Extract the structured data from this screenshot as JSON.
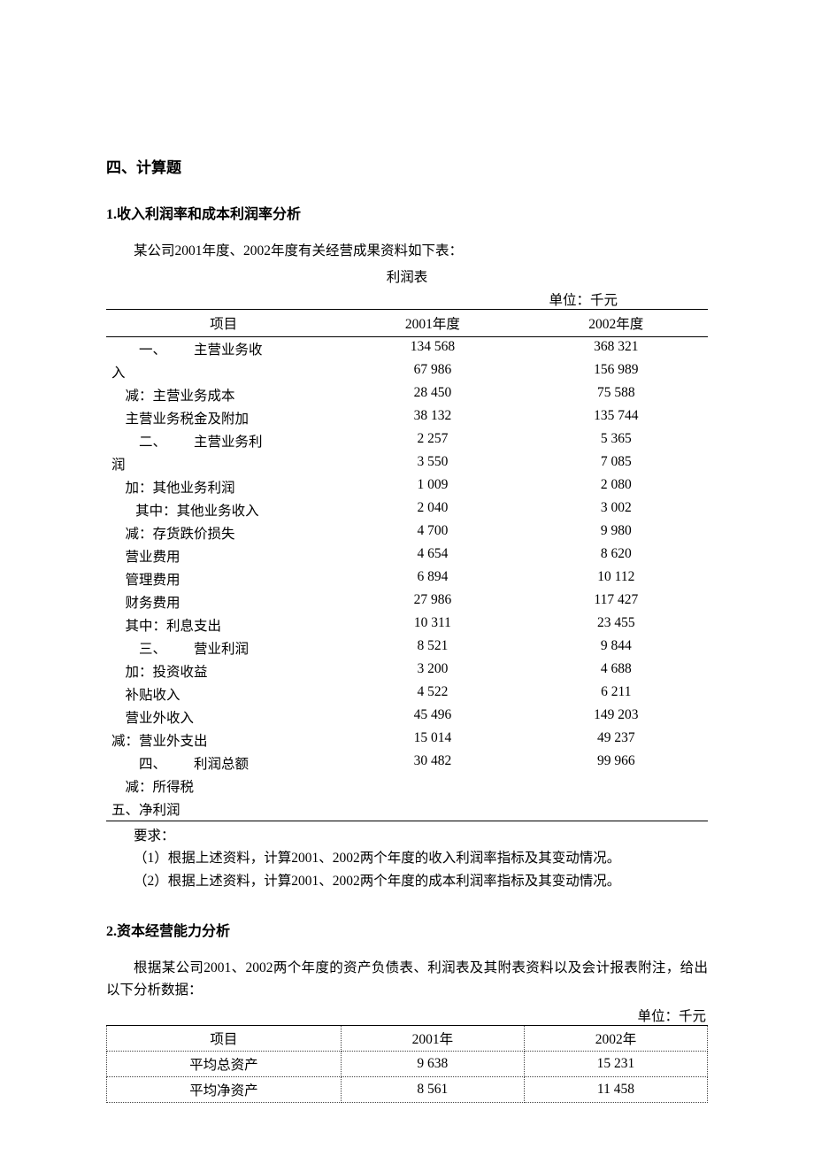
{
  "section_heading": "四、计算题",
  "q1": {
    "title": "1.收入利润率和成本利润率分析",
    "intro": "某公司2001年度、2002年度有关经营成果资料如下表：",
    "table_title": "利润表",
    "unit": "单位：千元",
    "columns": [
      "项目",
      "2001年度",
      "2002年度"
    ],
    "rows": [
      {
        "item": "        一、        主营业务收",
        "y2001": "134 568",
        "y2002": "368 321"
      },
      {
        "item": "入",
        "y2001": "67 986",
        "y2002": "156 989"
      },
      {
        "item": "    减：主营业务成本",
        "y2001": "28 450",
        "y2002": "75 588"
      },
      {
        "item": "    主营业务税金及附加",
        "y2001": "38 132",
        "y2002": "135 744"
      },
      {
        "item": "        二、        主营业务利",
        "y2001": "2 257",
        "y2002": "5 365"
      },
      {
        "item": "润",
        "y2001": "3 550",
        "y2002": "7 085"
      },
      {
        "item": "    加：其他业务利润",
        "y2001": "1 009",
        "y2002": "2 080"
      },
      {
        "item": "       其中：其他业务收入",
        "y2001": "2 040",
        "y2002": "3 002"
      },
      {
        "item": "    减：存货跌价损失",
        "y2001": "4 700",
        "y2002": "9 980"
      },
      {
        "item": "    营业费用",
        "y2001": "4 654",
        "y2002": "8 620"
      },
      {
        "item": "    管理费用",
        "y2001": "6 894",
        "y2002": "10 112"
      },
      {
        "item": "    财务费用",
        "y2001": "27 986",
        "y2002": "117 427"
      },
      {
        "item": "    其中：利息支出",
        "y2001": "10 311",
        "y2002": "23 455"
      },
      {
        "item": "        三、        营业利润",
        "y2001": "8 521",
        "y2002": "9 844"
      },
      {
        "item": "    加：投资收益",
        "y2001": "3 200",
        "y2002": "4 688"
      },
      {
        "item": "    补贴收入",
        "y2001": "4 522",
        "y2002": "6 211"
      },
      {
        "item": "    营业外收入",
        "y2001": "45 496",
        "y2002": "149 203"
      },
      {
        "item": "减：营业外支出",
        "y2001": "15 014",
        "y2002": "49 237"
      },
      {
        "item": "        四、        利润总额",
        "y2001": "30 482",
        "y2002": "99 966"
      },
      {
        "item": "    减：所得税",
        "y2001": "",
        "y2002": ""
      },
      {
        "item": "五、净利润",
        "y2001": "",
        "y2002": ""
      }
    ],
    "req_label": "要求：",
    "req1": "（1）根据上述资料，计算2001、2002两个年度的收入利润率指标及其变动情况。",
    "req2": "（2）根据上述资料，计算2001、2002两个年度的成本利润率指标及其变动情况。"
  },
  "q2": {
    "title": "2.资本经营能力分析",
    "intro": "根据某公司2001、2002两个年度的资产负债表、利润表及其附表资料以及会计报表附注，给出以下分析数据：",
    "unit": "单位：千元",
    "columns": [
      "项目",
      "2001年",
      "2002年"
    ],
    "rows": [
      {
        "item": "平均总资产",
        "y2001": "9 638",
        "y2002": "15 231"
      },
      {
        "item": "平均净资产",
        "y2001": "8 561",
        "y2002": "11 458"
      }
    ]
  }
}
